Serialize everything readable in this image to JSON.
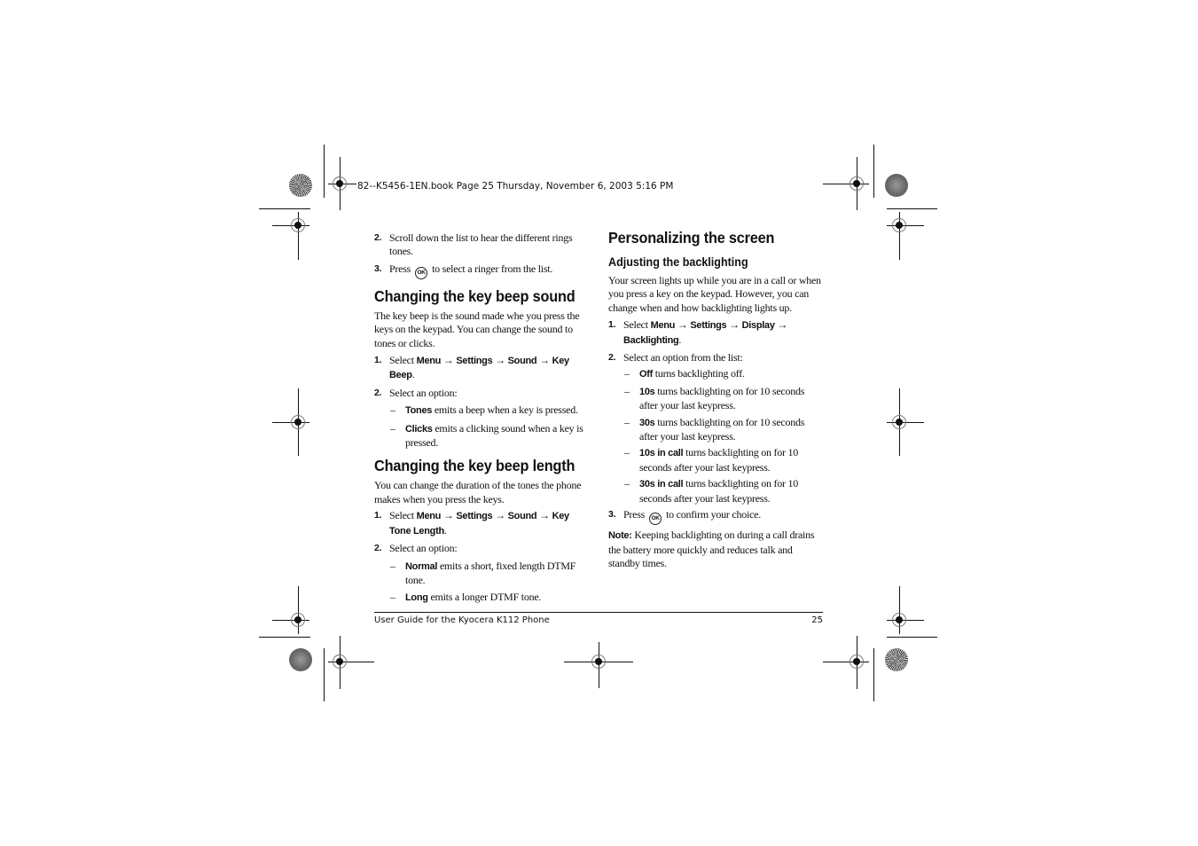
{
  "slug": "82--K5456-1EN.book  Page 25  Thursday, November 6, 2003  5:16 PM",
  "left_column": {
    "intro_steps": [
      {
        "num": "2.",
        "text": "Scroll down the list to hear the different rings tones."
      },
      {
        "num": "3.",
        "before": "Press",
        "icon": "ok-key-icon",
        "icon_label": "OK",
        "after": "to select a ringer from the list."
      }
    ],
    "section1": {
      "heading": "Changing the key beep sound",
      "body": "The key beep is the sound made whe you press the keys on the keypad. You can change the sound to tones or clicks.",
      "step1": {
        "num": "1.",
        "select": "Select",
        "path": [
          "Menu",
          "Settings",
          "Sound",
          "Key Beep"
        ],
        "arrow": "→",
        "end": "."
      },
      "step2": {
        "num": "2.",
        "text": "Select an option:"
      },
      "options": [
        {
          "term": "Tones",
          "text": "emits a beep when a key is pressed."
        },
        {
          "term": "Clicks",
          "text": "emits a clicking sound when a key is pressed."
        }
      ]
    },
    "section2": {
      "heading": "Changing the key beep length",
      "body": "You can change the duration of the tones the phone makes when you press the keys.",
      "step1": {
        "num": "1.",
        "select": "Select",
        "path": [
          "Menu",
          "Settings",
          "Sound",
          "Key Tone Length"
        ],
        "arrow": "→",
        "end": "."
      },
      "step2": {
        "num": "2.",
        "text": "Select an option:"
      },
      "options": [
        {
          "term": "Normal",
          "text": "emits a short, fixed length DTMF tone."
        },
        {
          "term": "Long",
          "text": "emits a longer DTMF tone."
        }
      ]
    }
  },
  "right_column": {
    "heading": "Personalizing the screen",
    "subheading": "Adjusting the backlighting",
    "body": "Your screen lights up while you are in a call or when you press a key on the keypad. However, you can change when and how backlighting lights up.",
    "step1": {
      "num": "1.",
      "select": "Select",
      "path": [
        "Menu",
        "Settings",
        "Display",
        "Backlighting"
      ],
      "arrow": "→",
      "end": "."
    },
    "step2": {
      "num": "2.",
      "text": "Select an option from the list:"
    },
    "options": [
      {
        "term": "Off",
        "text": "turns backlighting off."
      },
      {
        "term": "10s",
        "text": "turns backlighting on for 10 seconds after your last keypress."
      },
      {
        "term": "30s",
        "text": "turns backlighting on for 10 seconds after your last keypress."
      },
      {
        "term": "10s in call",
        "text": "turns backlighting on for 10 seconds after your last keypress."
      },
      {
        "term": "30s in call",
        "text": "turns backlighting on for 10 seconds after your last keypress."
      }
    ],
    "step3": {
      "num": "3.",
      "before": "Press",
      "icon_label": "OK",
      "after": "to confirm your choice."
    },
    "note": {
      "label": "Note:",
      "text": "Keeping backlighting on during a call drains the battery more quickly and reduces talk and standby times."
    }
  },
  "dash": "–",
  "footer": {
    "title": "User Guide for the Kyocera K112 Phone",
    "page_number": "25"
  }
}
